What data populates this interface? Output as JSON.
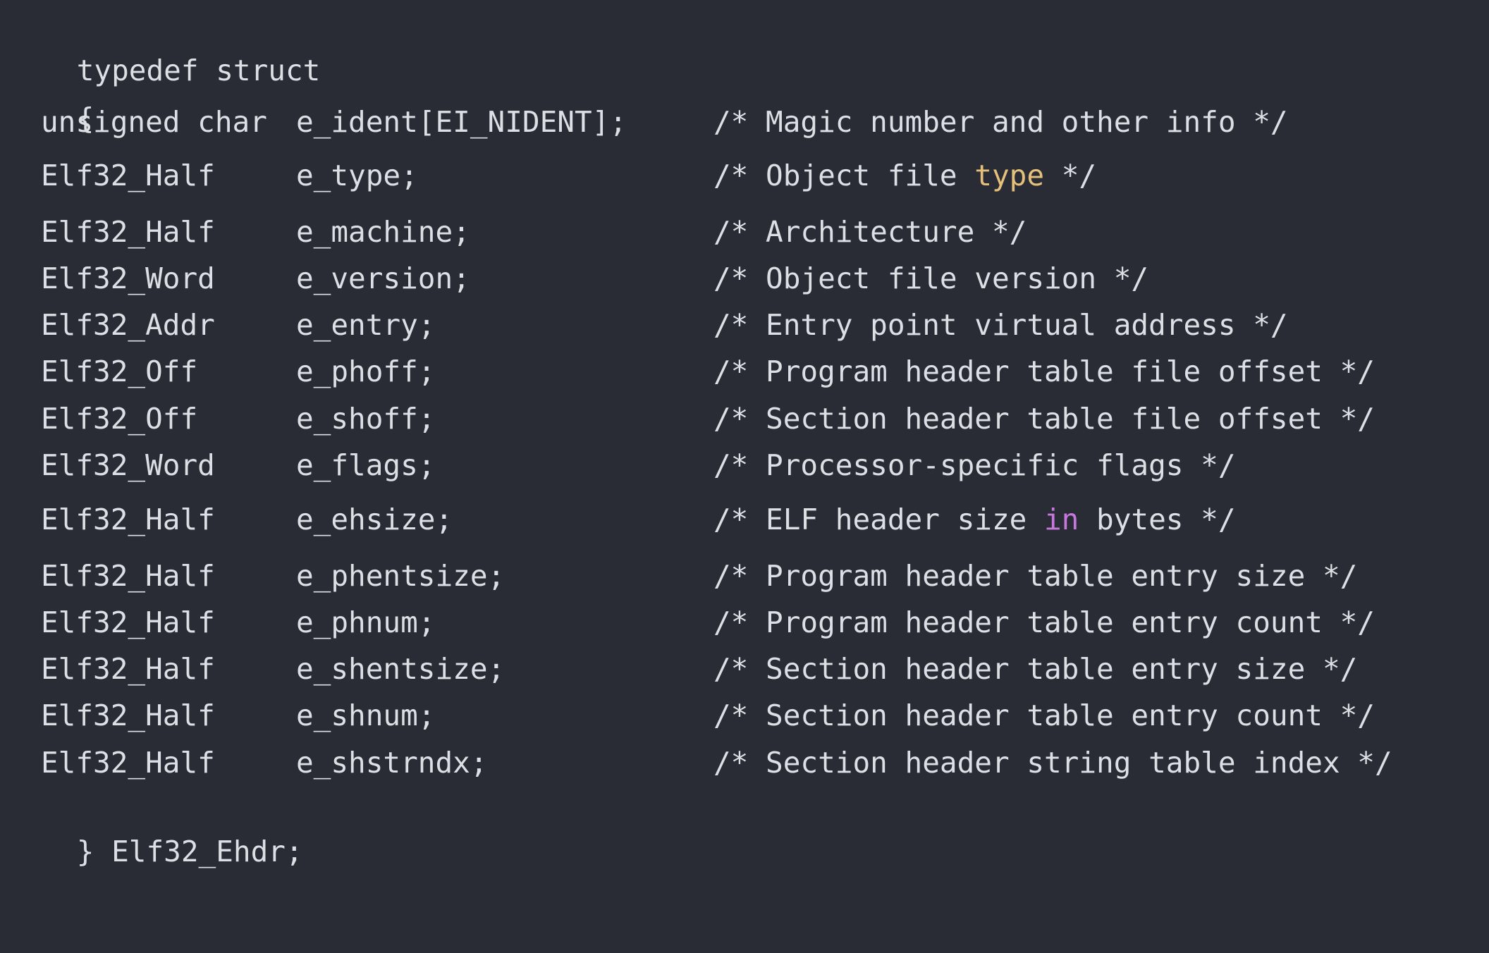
{
  "colors": {
    "background": "#292c34",
    "text": "#dcdfe4",
    "keyword_type_highlight": "#e5c07b",
    "keyword_in_highlight": "#c678dd"
  },
  "code": {
    "header": "typedef struct",
    "open_brace": "{",
    "close_line": "} Elf32_Ehdr;",
    "fields": [
      {
        "type": "unsigned char",
        "name": "e_ident[EI_NIDENT];",
        "comment": "/* Magic number and other info */"
      },
      {
        "type": "Elf32_Half",
        "name": "e_type;",
        "comment_before": "/* Object file ",
        "comment_highlight": "type",
        "comment_after": " */"
      },
      {
        "type": "Elf32_Half",
        "name": "e_machine;",
        "comment": "/* Architecture */"
      },
      {
        "type": "Elf32_Word",
        "name": "e_version;",
        "comment": "/* Object file version */"
      },
      {
        "type": "Elf32_Addr",
        "name": "e_entry;",
        "comment": "/* Entry point virtual address */"
      },
      {
        "type": "Elf32_Off",
        "name": "e_phoff;",
        "comment": "/* Program header table file offset */"
      },
      {
        "type": "Elf32_Off",
        "name": "e_shoff;",
        "comment": "/* Section header table file offset */"
      },
      {
        "type": "Elf32_Word",
        "name": "e_flags;",
        "comment": "/* Processor-specific flags */"
      },
      {
        "type": "Elf32_Half",
        "name": "e_ehsize;",
        "comment_before": "/* ELF header size ",
        "comment_highlight": "in",
        "comment_after": " bytes */"
      },
      {
        "type": "Elf32_Half",
        "name": "e_phentsize;",
        "comment": "/* Program header table entry size */"
      },
      {
        "type": "Elf32_Half",
        "name": "e_phnum;",
        "comment": "/* Program header table entry count */"
      },
      {
        "type": "Elf32_Half",
        "name": "e_shentsize;",
        "comment": "/* Section header table entry size */"
      },
      {
        "type": "Elf32_Half",
        "name": "e_shnum;",
        "comment": "/* Section header table entry count */"
      },
      {
        "type": "Elf32_Half",
        "name": "e_shstrndx;",
        "comment": "/* Section header string table index */"
      }
    ]
  }
}
